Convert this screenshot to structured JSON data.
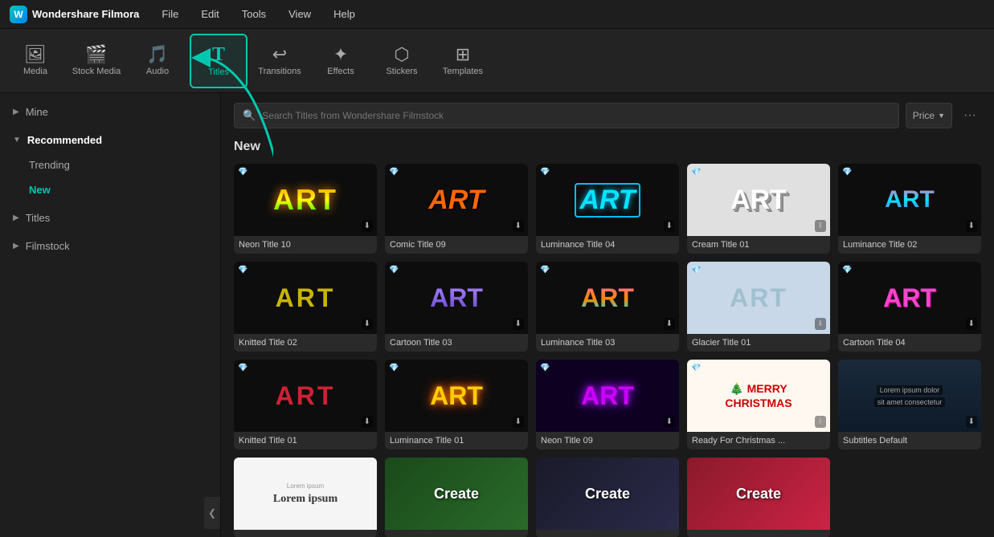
{
  "titlebar": {
    "app_name": "Wondershare Filmora",
    "menu_items": [
      "File",
      "Edit",
      "Tools",
      "View",
      "Help"
    ]
  },
  "toolbar": {
    "items": [
      {
        "id": "media",
        "label": "Media",
        "icon": "🖼"
      },
      {
        "id": "stock-media",
        "label": "Stock Media",
        "icon": "🎬"
      },
      {
        "id": "audio",
        "label": "Audio",
        "icon": "🎵"
      },
      {
        "id": "titles",
        "label": "Titles",
        "icon": "T",
        "active": true
      },
      {
        "id": "transitions",
        "label": "Transitions",
        "icon": "↩"
      },
      {
        "id": "effects",
        "label": "Effects",
        "icon": "✦"
      },
      {
        "id": "stickers",
        "label": "Stickers",
        "icon": "⬡"
      },
      {
        "id": "templates",
        "label": "Templates",
        "icon": "⊞"
      }
    ]
  },
  "sidebar": {
    "mine_label": "Mine",
    "recommended_label": "Recommended",
    "trending_label": "Trending",
    "new_label": "New",
    "titles_label": "Titles",
    "filmstock_label": "Filmstock"
  },
  "search": {
    "placeholder": "Search Titles from Wondershare Filmstock",
    "price_filter": "Price",
    "more": "···"
  },
  "content": {
    "section_label": "New",
    "titles": [
      {
        "id": "neon10",
        "label": "Neon Title 10",
        "art": "ART",
        "style": "neon10"
      },
      {
        "id": "comic09",
        "label": "Comic Title 09",
        "art": "ART",
        "style": "comic09"
      },
      {
        "id": "lum04",
        "label": "Luminance Title 04",
        "art": "ART",
        "style": "lum04"
      },
      {
        "id": "cream01",
        "label": "Cream Title 01",
        "art": "ART",
        "style": "cream01"
      },
      {
        "id": "lum02",
        "label": "Luminance Title 02",
        "art": "ART",
        "style": "lum02"
      },
      {
        "id": "knitted02",
        "label": "Knitted Title 02",
        "art": "ART",
        "style": "knitted02"
      },
      {
        "id": "cartoon03",
        "label": "Cartoon Title 03",
        "art": "ART",
        "style": "cartoon03"
      },
      {
        "id": "lum03",
        "label": "Luminance Title 03",
        "art": "ART",
        "style": "lum03"
      },
      {
        "id": "glacier01",
        "label": "Glacier Title 01",
        "art": "ART",
        "style": "glacier01"
      },
      {
        "id": "cartoon04",
        "label": "Cartoon Title 04",
        "art": "ART",
        "style": "cartoon04"
      },
      {
        "id": "knitted01",
        "label": "Knitted Title 01",
        "art": "ART",
        "style": "knitted01"
      },
      {
        "id": "lum01",
        "label": "Luminance Title 01",
        "art": "ART",
        "style": "lum01"
      },
      {
        "id": "neon09",
        "label": "Neon Title 09",
        "art": "ART",
        "style": "neon09"
      },
      {
        "id": "christmas",
        "label": "Ready For Christmas ...",
        "special": "christmas"
      },
      {
        "id": "subtitles",
        "label": "Subtitles Default",
        "special": "subtitles"
      },
      {
        "id": "lorem",
        "label": "",
        "special": "lorem"
      },
      {
        "id": "green",
        "label": "",
        "special": "green"
      },
      {
        "id": "create2",
        "label": "",
        "special": "create2"
      },
      {
        "id": "create3",
        "label": "",
        "special": "create3"
      }
    ]
  },
  "arrow": {
    "color": "#00c8b0"
  }
}
